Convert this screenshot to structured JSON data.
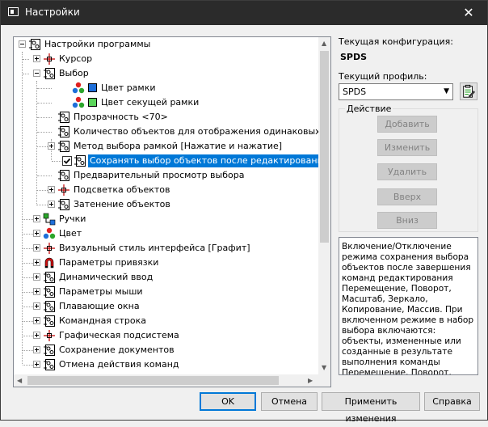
{
  "window": {
    "title": "Настройки",
    "close_glyph": "✕"
  },
  "tree": {
    "root": "Настройки программы",
    "items": [
      {
        "label": "Курсор",
        "icon": "cursor-icon"
      },
      {
        "label": "Выбор",
        "icon": "settings-icon"
      },
      {
        "label": "Цвет рамки",
        "icon": "color-dots-icon",
        "swatch": "#1e6fd9"
      },
      {
        "label": "Цвет секущей рамки",
        "icon": "color-dots-icon",
        "swatch": "#5cd65c"
      },
      {
        "label": "Прозрачность <70>",
        "icon": "settings-icon"
      },
      {
        "label": "Количество объектов для отображения одинаковых свой",
        "icon": "settings-icon"
      },
      {
        "label": "Метод выбора рамкой [Нажатие и нажатие]",
        "icon": "settings-icon"
      },
      {
        "label": "Сохранять выбор объектов после редактирования",
        "icon": "settings-icon",
        "checked": true
      },
      {
        "label": "Предварительный просмотр выбора",
        "icon": "settings-icon"
      },
      {
        "label": "Подсветка объектов",
        "icon": "cursor-icon"
      },
      {
        "label": "Затенение объектов",
        "icon": "settings-icon"
      },
      {
        "label": "Ручки",
        "icon": "grips-icon"
      },
      {
        "label": "Цвет",
        "icon": "color-dots-icon"
      },
      {
        "label": "Визуальный стиль интерфейса [Графит]",
        "icon": "cursor-icon"
      },
      {
        "label": "Параметры привязки",
        "icon": "magnet-icon"
      },
      {
        "label": "Динамический ввод",
        "icon": "settings-icon"
      },
      {
        "label": "Параметры мыши",
        "icon": "settings-icon"
      },
      {
        "label": "Плавающие окна",
        "icon": "settings-icon"
      },
      {
        "label": "Командная строка",
        "icon": "settings-icon"
      },
      {
        "label": "Графическая подсистема",
        "icon": "cursor-icon"
      },
      {
        "label": "Сохранение документов",
        "icon": "settings-icon"
      },
      {
        "label": "Отмена действия команд",
        "icon": "settings-icon"
      }
    ]
  },
  "config": {
    "label": "Текущая конфигурация:",
    "value": "SPDS"
  },
  "profile": {
    "label": "Текущий профиль:",
    "value": "SPDS"
  },
  "action_group": {
    "title": "Действие",
    "buttons": [
      "Добавить",
      "Изменить",
      "Удалить",
      "Вверх",
      "Вниз"
    ]
  },
  "description": "Включение/Отключение режима сохранения выбора объектов после завершения команд редактирования Перемещение, Поворот, Масштаб, Зеркало, Копирование, Массив. При включенном режиме в набор выбора включаются: объекты, измененные или созданные в результате выполнения команды Перемещение, Поворот, Масштаб, Зеркало",
  "footer": {
    "ok": "OK",
    "cancel": "Отмена",
    "apply": "Применить изменения",
    "help": "Справка"
  },
  "colors": {
    "accent": "#0078d7",
    "titlebar": "#2b2b2b"
  }
}
